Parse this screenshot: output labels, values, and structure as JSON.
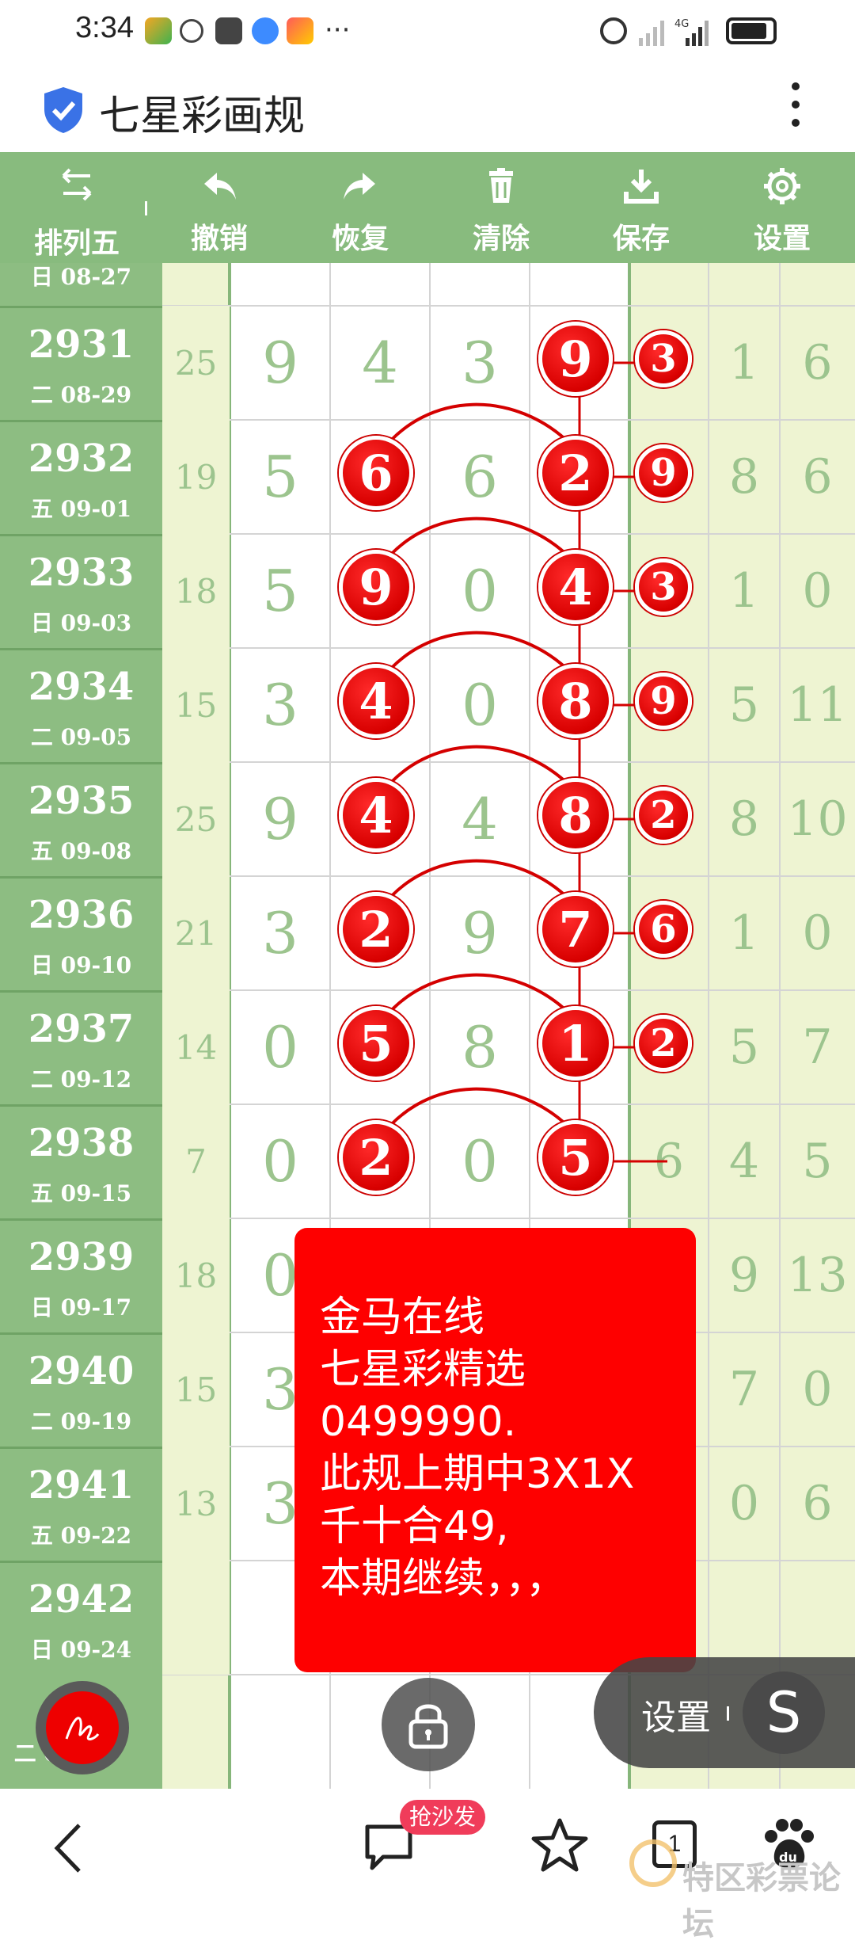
{
  "status": {
    "time": "3:34"
  },
  "app": {
    "title": "七星彩画规"
  },
  "toolbar": {
    "left_label": "排列五",
    "undo": "撤销",
    "redo": "恢复",
    "clear": "清除",
    "save": "保存",
    "settings": "设置"
  },
  "partial_top_date": "日 08-27",
  "rows": [
    {
      "issue": "2931",
      "date": "二 08-29",
      "sum": "25",
      "d": [
        "9",
        "4",
        "3",
        "9"
      ],
      "extra": "3",
      "r": [
        "1",
        "6"
      ]
    },
    {
      "issue": "2932",
      "date": "五 09-01",
      "sum": "19",
      "d": [
        "5",
        "6",
        "6",
        "2"
      ],
      "extra": "9",
      "r": [
        "8",
        "6"
      ]
    },
    {
      "issue": "2933",
      "date": "日 09-03",
      "sum": "18",
      "d": [
        "5",
        "9",
        "0",
        "4"
      ],
      "extra": "3",
      "r": [
        "1",
        "0"
      ]
    },
    {
      "issue": "2934",
      "date": "二 09-05",
      "sum": "15",
      "d": [
        "3",
        "4",
        "0",
        "8"
      ],
      "extra": "9",
      "r": [
        "5",
        "11"
      ]
    },
    {
      "issue": "2935",
      "date": "五 09-08",
      "sum": "25",
      "d": [
        "9",
        "4",
        "4",
        "8"
      ],
      "extra": "2",
      "r": [
        "8",
        "10"
      ]
    },
    {
      "issue": "2936",
      "date": "日 09-10",
      "sum": "21",
      "d": [
        "3",
        "2",
        "9",
        "7"
      ],
      "extra": "6",
      "r": [
        "1",
        "0"
      ]
    },
    {
      "issue": "2937",
      "date": "二 09-12",
      "sum": "14",
      "d": [
        "0",
        "5",
        "8",
        "1"
      ],
      "extra": "2",
      "r": [
        "5",
        "7"
      ]
    },
    {
      "issue": "2938",
      "date": "五 09-15",
      "sum": "7",
      "d": [
        "0",
        "2",
        "0",
        "5"
      ],
      "extra": "6",
      "r": [
        "4",
        "5"
      ]
    },
    {
      "issue": "2939",
      "date": "日 09-17",
      "sum": "18",
      "d": [
        "0",
        "",
        "",
        ""
      ],
      "extra": "",
      "r": [
        "9",
        "13"
      ]
    },
    {
      "issue": "2940",
      "date": "二 09-19",
      "sum": "15",
      "d": [
        "3",
        "",
        "",
        ""
      ],
      "extra": "",
      "r": [
        "7",
        "0"
      ]
    },
    {
      "issue": "2941",
      "date": "五 09-22",
      "sum": "13",
      "d": [
        "3",
        "",
        "",
        ""
      ],
      "extra": "",
      "r": [
        "0",
        "6"
      ]
    },
    {
      "issue": "2942",
      "date": "日 09-24",
      "sum": "",
      "d": [
        "",
        "",
        "",
        ""
      ],
      "extra": "",
      "r": [
        "",
        ""
      ]
    }
  ],
  "partial_bottom_date": "二 09-26",
  "popup": {
    "lines": [
      "金马在线",
      "七星彩精选",
      "0499990.",
      "此规上期中3X1X",
      "千十合49,",
      "本期继续，，，"
    ]
  },
  "float_settings": {
    "label": "设置"
  },
  "bottom": {
    "badge": "抢沙发",
    "tabs_count": "1",
    "watermark": "特区彩票论坛"
  },
  "colors": {
    "green": "#88bb7e",
    "light_green": "#eef4d2",
    "digit": "#9cc48e",
    "ball_red": "#e00000",
    "popup_red": "#fe0000"
  }
}
